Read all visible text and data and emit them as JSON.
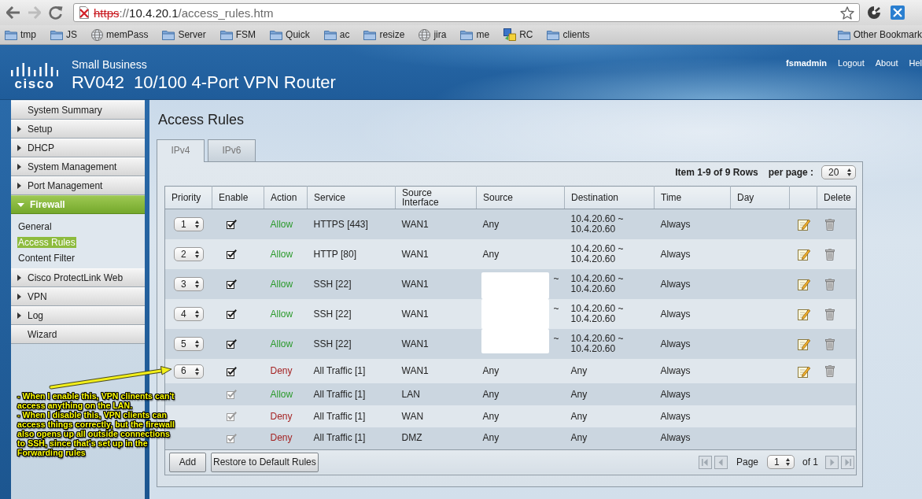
{
  "browser": {
    "address": {
      "scheme": "https",
      "separator": "://",
      "host": "10.4.20.1",
      "path": "/access_rules.htm",
      "secure": false
    },
    "bookmarks": [
      {
        "label": "tmp",
        "kind": "folder"
      },
      {
        "label": "JS",
        "kind": "folder"
      },
      {
        "label": "memPass",
        "kind": "globe"
      },
      {
        "label": "Server",
        "kind": "folder"
      },
      {
        "label": "FSM",
        "kind": "folder"
      },
      {
        "label": "Quick",
        "kind": "folder"
      },
      {
        "label": "ac",
        "kind": "folder"
      },
      {
        "label": "resize",
        "kind": "folder"
      },
      {
        "label": "jira",
        "kind": "globe"
      },
      {
        "label": "me",
        "kind": "folder"
      },
      {
        "label": "RC",
        "kind": "app"
      },
      {
        "label": "clients",
        "kind": "folder"
      }
    ],
    "other_bookmarks": "Other Bookmark"
  },
  "header": {
    "logo_text": "cisco",
    "product_line": "Small Business",
    "title": "RV042  10/100 4-Port VPN Router",
    "user": "fsmadmin",
    "links": [
      "Logout",
      "About",
      "Hel"
    ]
  },
  "sidebar": {
    "items": [
      {
        "label": "System Summary",
        "kind": "link"
      },
      {
        "label": "Setup",
        "kind": "section",
        "expanded": false
      },
      {
        "label": "DHCP",
        "kind": "section",
        "expanded": false
      },
      {
        "label": "System Management",
        "kind": "section",
        "expanded": false
      },
      {
        "label": "Port Management",
        "kind": "section",
        "expanded": false
      },
      {
        "label": "Firewall",
        "kind": "section",
        "expanded": true,
        "children": [
          {
            "label": "General",
            "selected": false
          },
          {
            "label": "Access Rules",
            "selected": true
          },
          {
            "label": "Content Filter",
            "selected": false
          }
        ]
      },
      {
        "label": "Cisco ProtectLink Web",
        "kind": "section",
        "expanded": false
      },
      {
        "label": "VPN",
        "kind": "section",
        "expanded": false
      },
      {
        "label": "Log",
        "kind": "section",
        "expanded": false
      },
      {
        "label": "Wizard",
        "kind": "link"
      }
    ]
  },
  "page": {
    "title": "Access Rules",
    "tabs": [
      {
        "label": "IPv4",
        "selected": true
      },
      {
        "label": "IPv6",
        "selected": false
      }
    ],
    "summary": "Item 1-9 of 9 Rows",
    "per_page_label": "per page :",
    "per_page": "20",
    "table": {
      "columns": [
        "Priority",
        "Enable",
        "Action",
        "Service",
        "Source Interface",
        "Source",
        "Destination",
        "Time",
        "Day",
        "Delete"
      ],
      "rows": [
        {
          "kind": "custom",
          "priority": "1",
          "enable": {
            "checked": true,
            "disabled": false
          },
          "action": {
            "text": "Allow",
            "kind": "allow"
          },
          "service": "HTTPS [443]",
          "interface": "WAN1",
          "source": {
            "text": "Any",
            "redacted": false
          },
          "destination": "10.4.20.60 ~ 10.4.20.60",
          "time": "Always"
        },
        {
          "kind": "custom",
          "priority": "2",
          "enable": {
            "checked": true,
            "disabled": false
          },
          "action": {
            "text": "Allow",
            "kind": "allow"
          },
          "service": "HTTP [80]",
          "interface": "WAN1",
          "source": {
            "text": "Any",
            "redacted": false
          },
          "destination": "10.4.20.60 ~ 10.4.20.60",
          "time": "Always"
        },
        {
          "kind": "custom",
          "priority": "3",
          "enable": {
            "checked": true,
            "disabled": false
          },
          "action": {
            "text": "Allow",
            "kind": "allow"
          },
          "service": "SSH [22]",
          "interface": "WAN1",
          "source": {
            "text": "~",
            "redacted": true
          },
          "destination": "10.4.20.60 ~ 10.4.20.60",
          "time": "Always"
        },
        {
          "kind": "custom",
          "priority": "4",
          "enable": {
            "checked": true,
            "disabled": false
          },
          "action": {
            "text": "Allow",
            "kind": "allow"
          },
          "service": "SSH [22]",
          "interface": "WAN1",
          "source": {
            "text": "~",
            "redacted": true
          },
          "destination": "10.4.20.60 ~ 10.4.20.60",
          "time": "Always"
        },
        {
          "kind": "custom",
          "priority": "5",
          "enable": {
            "checked": true,
            "disabled": false
          },
          "action": {
            "text": "Allow",
            "kind": "allow"
          },
          "service": "SSH [22]",
          "interface": "WAN1",
          "source": {
            "text": "~",
            "redacted": true
          },
          "destination": "10.4.20.60 ~ 10.4.20.60",
          "time": "Always"
        },
        {
          "kind": "custom",
          "priority": "6",
          "enable": {
            "checked": true,
            "disabled": false
          },
          "action": {
            "text": "Deny",
            "kind": "deny"
          },
          "service": "All Traffic [1]",
          "interface": "WAN1",
          "source": {
            "text": "Any",
            "redacted": false
          },
          "destination": "Any",
          "time": "Always"
        },
        {
          "kind": "default",
          "enable": {
            "checked": true,
            "disabled": true
          },
          "action": {
            "text": "Allow",
            "kind": "allow"
          },
          "service": "All Traffic [1]",
          "interface": "LAN",
          "source": {
            "text": "Any",
            "redacted": false
          },
          "destination": "Any",
          "time": "Always"
        },
        {
          "kind": "default",
          "enable": {
            "checked": true,
            "disabled": true
          },
          "action": {
            "text": "Deny",
            "kind": "deny"
          },
          "service": "All Traffic [1]",
          "interface": "WAN",
          "source": {
            "text": "Any",
            "redacted": false
          },
          "destination": "Any",
          "time": "Always"
        },
        {
          "kind": "default",
          "enable": {
            "checked": true,
            "disabled": true
          },
          "action": {
            "text": "Deny",
            "kind": "deny"
          },
          "service": "All Traffic [1]",
          "interface": "DMZ",
          "source": {
            "text": "Any",
            "redacted": false
          },
          "destination": "Any",
          "time": "Always"
        }
      ]
    },
    "footer": {
      "add_button": "Add",
      "restore_button": "Restore to Default Rules",
      "page_label": "Page",
      "page": "1",
      "page_count": "of 1"
    }
  },
  "annotation": {
    "notes": [
      "- When I enable this, VPN clinents can't access anything on the LAN.",
      "- When I disable this, VPN clients can access things correctly, but the firewall also opens up all outside connections to SSH, since that's set up in the Forwarding rules"
    ]
  }
}
